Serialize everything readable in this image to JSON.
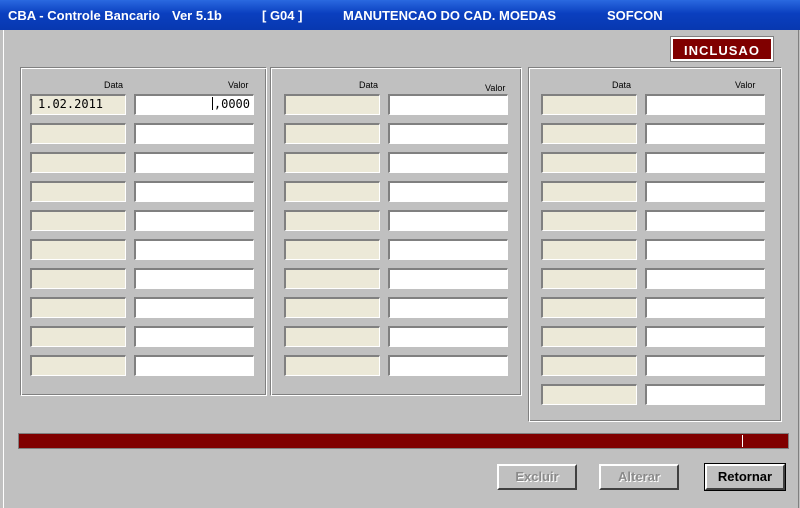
{
  "window": {
    "app": "CBA - Controle Bancario",
    "version": "Ver 5.1b",
    "code": "[ G04 ]",
    "screen": "MANUTENCAO DO CAD. MOEDAS",
    "company": "SOFCON"
  },
  "mode_badge": "INCLUSAO",
  "headers": {
    "data": "Data",
    "valor": "Valor"
  },
  "first_row": {
    "date": "1.02.2011",
    "value": ",0000"
  },
  "buttons": {
    "excluir": "Excluir",
    "alterar": "Alterar",
    "retornar": "Retornar"
  }
}
